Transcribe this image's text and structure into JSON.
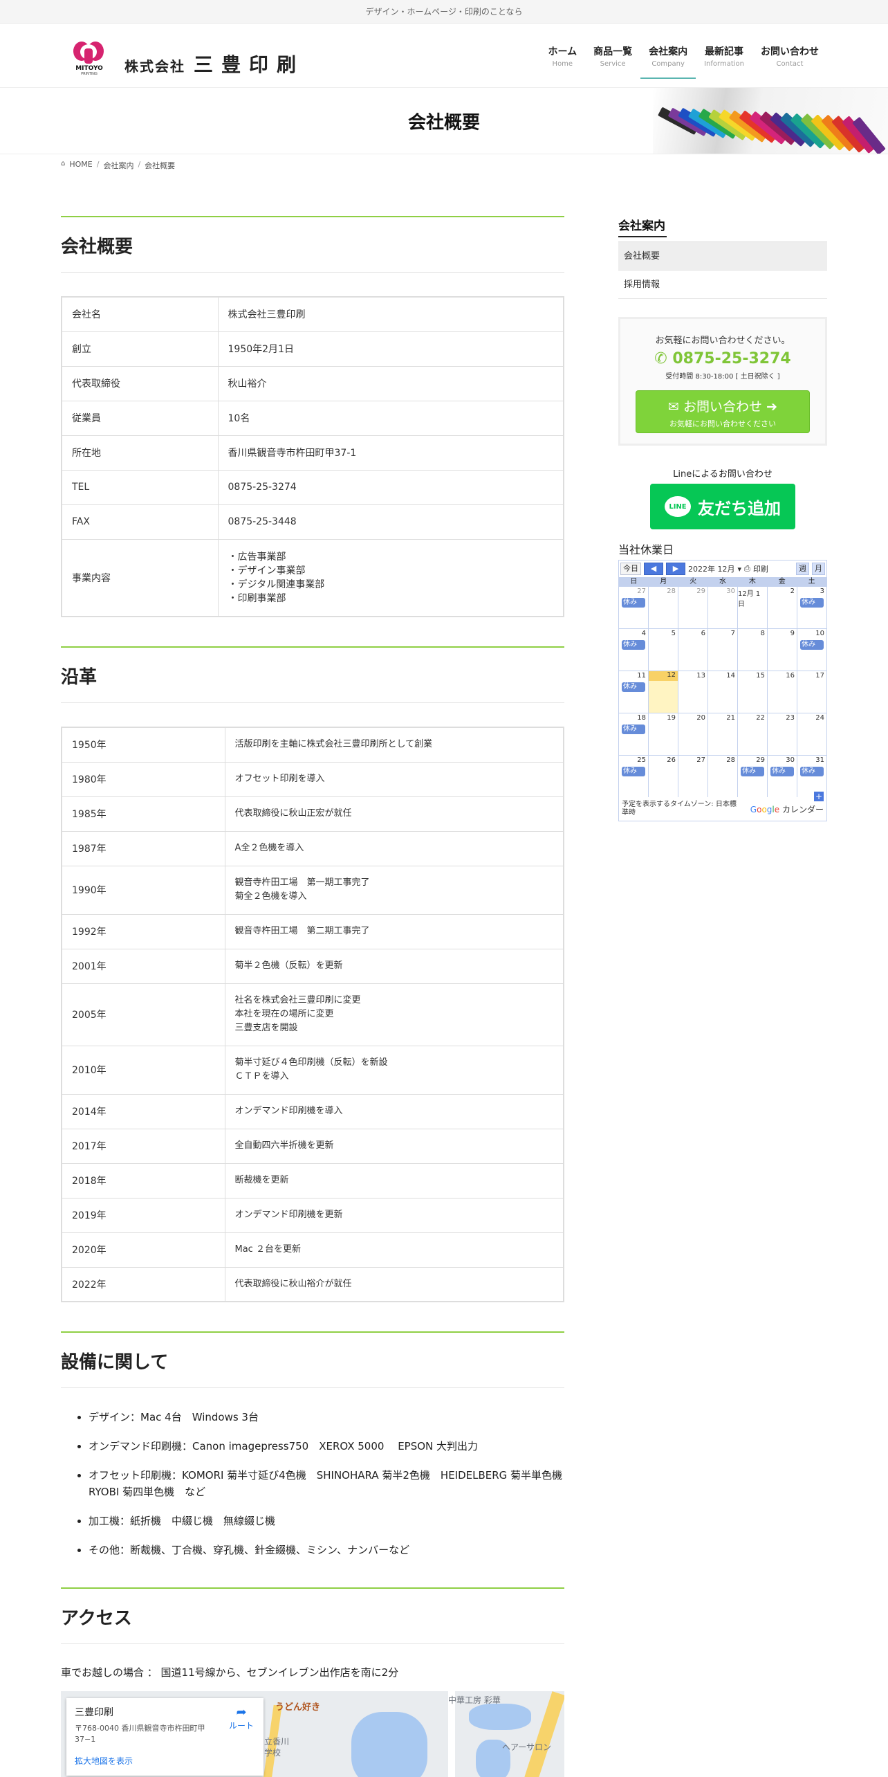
{
  "topbar": {
    "tagline": "デザイン・ホームページ・印刷のことなら"
  },
  "header": {
    "logo_word": "MITOYO",
    "logo_sub": "PRINTING",
    "company_prefix": "株式会社",
    "company_main": "三豊印刷",
    "nav": [
      {
        "jp": "ホーム",
        "en": "Home"
      },
      {
        "jp": "商品一覧",
        "en": "Service"
      },
      {
        "jp": "会社案内",
        "en": "Company"
      },
      {
        "jp": "最新記事",
        "en": "Information"
      },
      {
        "jp": "お問い合わせ",
        "en": "Contact"
      }
    ],
    "active_nav": "会社案内"
  },
  "page_title": "会社概要",
  "breadcrumb": {
    "home": "HOME",
    "parent": "会社案内",
    "current": "会社概要"
  },
  "overview": {
    "title": "会社概要",
    "rows": [
      {
        "k": "会社名",
        "v": "株式会社三豊印刷"
      },
      {
        "k": "創立",
        "v": "1950年2月1日"
      },
      {
        "k": "代表取締役",
        "v": "秋山裕介"
      },
      {
        "k": "従業員",
        "v": "10名"
      },
      {
        "k": "所在地",
        "v": "香川県観音寺市杵田町甲37-1"
      },
      {
        "k": "TEL",
        "v": "0875-25-3274"
      },
      {
        "k": "FAX",
        "v": "0875-25-3448"
      }
    ],
    "business_label": "事業内容",
    "business": [
      "・広告事業部",
      "・デザイン事業部",
      "・デジタル関連事業部",
      "・印刷事業部"
    ]
  },
  "history": {
    "title": "沿革",
    "rows": [
      {
        "k": "1950年",
        "v": [
          "活版印刷を主軸に株式会社三豊印刷所として創業"
        ]
      },
      {
        "k": "1980年",
        "v": [
          "オフセット印刷を導入"
        ]
      },
      {
        "k": "1985年",
        "v": [
          "代表取締役に秋山正宏が就任"
        ]
      },
      {
        "k": "1987年",
        "v": [
          "A全２色機を導入"
        ]
      },
      {
        "k": "1990年",
        "v": [
          "観音寺杵田工場　第一期工事完了",
          "菊全２色機を導入"
        ]
      },
      {
        "k": "1992年",
        "v": [
          "観音寺杵田工場　第二期工事完了"
        ]
      },
      {
        "k": "2001年",
        "v": [
          "菊半２色機（反転）を更新"
        ]
      },
      {
        "k": "2005年",
        "v": [
          "社名を株式会社三豊印刷に変更",
          "本社を現在の場所に変更",
          "三豊支店を開設"
        ]
      },
      {
        "k": "2010年",
        "v": [
          "菊半寸延び４色印刷機（反転）を新設",
          "ＣＴＰを導入"
        ]
      },
      {
        "k": "2014年",
        "v": [
          "オンデマンド印刷機を導入"
        ]
      },
      {
        "k": "2017年",
        "v": [
          "全自動四六半折機を更新"
        ]
      },
      {
        "k": "2018年",
        "v": [
          "断裁機を更新"
        ]
      },
      {
        "k": "2019年",
        "v": [
          "オンデマンド印刷機を更新"
        ]
      },
      {
        "k": "2020年",
        "v": [
          "Mac ２台を更新"
        ]
      },
      {
        "k": "2022年",
        "v": [
          "代表取締役に秋山裕介が就任"
        ]
      }
    ]
  },
  "equipment": {
    "title": "設備に関して",
    "items": [
      "デザイン：Mac 4台　Windows 3台",
      "オンデマンド印刷機：Canon imagepress750　XEROX 5000　 EPSON 大判出力",
      "オフセット印刷機：KOMORI 菊半寸延び4色機　SHINOHARA 菊半2色機　HEIDELBERG 菊半単色機　RYOBI 菊四単色機　など",
      "加工機：紙折機　中綴じ機　無線綴じ機",
      "その他：断裁機、丁合機、穿孔機、針金綴機、ミシン、ナンバーなど"
    ]
  },
  "access": {
    "title": "アクセス",
    "text": "車でお越しの場合 ： 国道11号線から、セブンイレブン出作店を南に2分",
    "map": {
      "place": "三豊印刷",
      "address": "〒768-0040 香川県観音寺市杵田町甲37−1",
      "route": "ルート",
      "enlarge": "拡大地図を表示",
      "label_udon": "うどん好き",
      "label_chuka": "中華工房 彩華",
      "label_salon": "ヘアーサロン",
      "label_school": "立香川",
      "label_school2": "学校"
    }
  },
  "sidebar": {
    "title": "会社案内",
    "items": [
      "会社概要",
      "採用情報"
    ],
    "contact": {
      "question": "お気軽にお問い合わせください。",
      "tel": "0875-25-3274",
      "hours": "受付時間 8:30-18:00 [ 土日祝除く ]",
      "btn_main": "お問い合わせ",
      "btn_sub": "お気軽にお問い合わせください"
    },
    "line": {
      "caption": "Lineによるお問い合わせ",
      "logo": "LINE",
      "button": "友だち追加"
    },
    "calendar": {
      "title": "当社休業日",
      "today_btn": "今日",
      "month_label": "2022年 12月",
      "print": "印刷",
      "week": "週",
      "month": "月",
      "dow": [
        "日",
        "月",
        "火",
        "水",
        "木",
        "金",
        "土"
      ],
      "weeks": [
        [
          [
            "27",
            true
          ],
          [
            "28",
            true
          ],
          [
            "29",
            true
          ],
          [
            "30",
            true
          ],
          [
            "12月 1日",
            false
          ],
          [
            "2",
            false
          ],
          [
            "3",
            false
          ]
        ],
        [
          [
            "4",
            false
          ],
          [
            "5",
            false
          ],
          [
            "6",
            false
          ],
          [
            "7",
            false
          ],
          [
            "8",
            false
          ],
          [
            "9",
            false
          ],
          [
            "10",
            false
          ]
        ],
        [
          [
            "11",
            false
          ],
          [
            "12",
            false
          ],
          [
            "13",
            false
          ],
          [
            "14",
            false
          ],
          [
            "15",
            false
          ],
          [
            "16",
            false
          ],
          [
            "17",
            false
          ]
        ],
        [
          [
            "18",
            false
          ],
          [
            "19",
            false
          ],
          [
            "20",
            false
          ],
          [
            "21",
            false
          ],
          [
            "22",
            false
          ],
          [
            "23",
            false
          ],
          [
            "24",
            false
          ]
        ],
        [
          [
            "25",
            false
          ],
          [
            "26",
            false
          ],
          [
            "27",
            false
          ],
          [
            "28",
            false
          ],
          [
            "29",
            false
          ],
          [
            "30",
            false
          ],
          [
            "31",
            false
          ]
        ]
      ],
      "today": "12",
      "event_label": "休み",
      "events": [
        [
          0,
          0
        ],
        [
          0,
          6
        ],
        [
          1,
          0
        ],
        [
          1,
          6
        ],
        [
          2,
          0
        ],
        [
          3,
          0
        ],
        [
          4,
          0
        ],
        [
          4,
          4
        ],
        [
          4,
          5
        ],
        [
          4,
          6
        ]
      ],
      "tz_note": "予定を表示するタイムゾーン: 日本標準時",
      "google_cal": "カレンダー"
    }
  }
}
